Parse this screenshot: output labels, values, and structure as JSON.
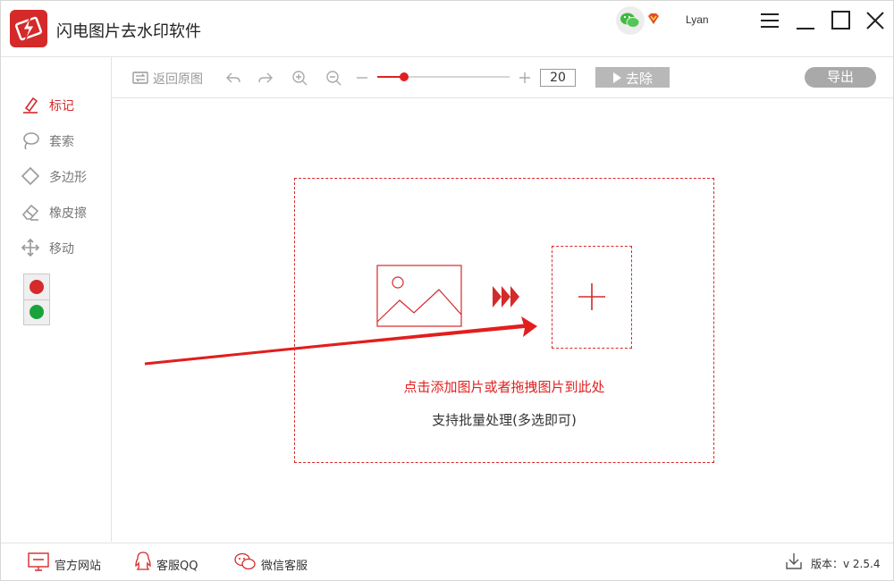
{
  "app": {
    "title": "闪电图片去水印软件",
    "user_name": "Lyan",
    "accent_color": "#d42a2a"
  },
  "title_icons": [
    "wechat-icon",
    "vip-icon",
    "menu-icon",
    "minimize-icon",
    "maximize-icon",
    "close-icon"
  ],
  "sidebar": {
    "tools": [
      {
        "label": "标记",
        "icon": "marker-icon",
        "active": true
      },
      {
        "label": "套索",
        "icon": "lasso-icon",
        "active": false
      },
      {
        "label": "多边形",
        "icon": "polygon-icon",
        "active": false
      },
      {
        "label": "橡皮擦",
        "icon": "eraser-icon",
        "active": false
      },
      {
        "label": "移动",
        "icon": "move-icon",
        "active": false
      }
    ],
    "colors": [
      "#d42a2a",
      "#1aa33c"
    ]
  },
  "toolbar": {
    "restore_label": "返回原图",
    "brush_size": "20",
    "brush_level": 0.2,
    "remove_label": "去除",
    "export_label": "导出"
  },
  "dropzone": {
    "hint": "点击添加图片或者拖拽图片到此处",
    "sub": "支持批量处理(多选即可)"
  },
  "footer": {
    "website_label": "官方网站",
    "qq_label": "客服QQ",
    "wechat_label": "微信客服",
    "version_label": "版本：v 2.5.4"
  }
}
